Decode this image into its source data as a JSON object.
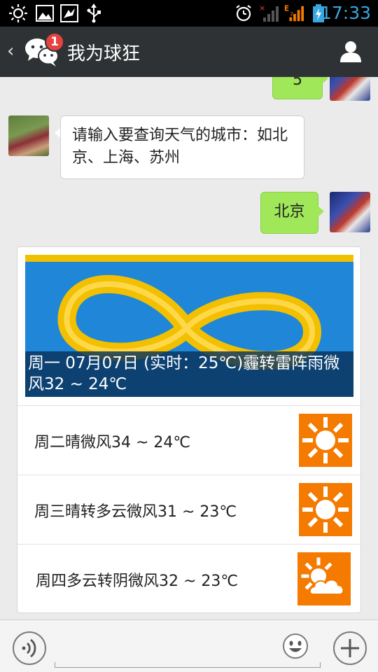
{
  "status_bar": {
    "time": "17:33",
    "network_label": "E",
    "sim_label": "2",
    "icons": [
      "brightness-icon",
      "image-icon",
      "bird-icon",
      "usb-icon",
      "alarm-icon",
      "no-signal-icon",
      "signal-icon",
      "battery-charging-icon"
    ]
  },
  "header": {
    "title": "我为球狂",
    "unread_badge": "1",
    "back_icon": "back-arrow-icon",
    "app_icon": "wechat-icon",
    "profile_icon": "user-profile-icon"
  },
  "messages": [
    {
      "from": "me",
      "text": "5"
    },
    {
      "from": "other",
      "text": "请输入要查询天气的城市：如北京、上海、苏州"
    },
    {
      "from": "me",
      "text": "北京"
    }
  ],
  "news_card": {
    "hero_caption": "周一 07月07日 (实时：25℃)霾转雷阵雨微风32 ~ 24℃",
    "items": [
      {
        "text": "周二晴微风34 ~ 24℃",
        "icon": "sunny-icon"
      },
      {
        "text": "周三晴转多云微风31 ~ 23℃",
        "icon": "sunny-icon"
      },
      {
        "text": "周四多云转阴微风32 ~ 23℃",
        "icon": "partly-cloudy-icon"
      }
    ]
  },
  "input_bar": {
    "voice_icon": "voice-icon",
    "emoji_icon": "emoji-icon",
    "plus_icon": "plus-icon"
  },
  "colors": {
    "accent_time": "#3aa6e0",
    "header_bg": "#2f3234",
    "bubble_me": "#a0e75a",
    "weather_icon_bg": "#f47a00",
    "badge": "#e64340"
  }
}
